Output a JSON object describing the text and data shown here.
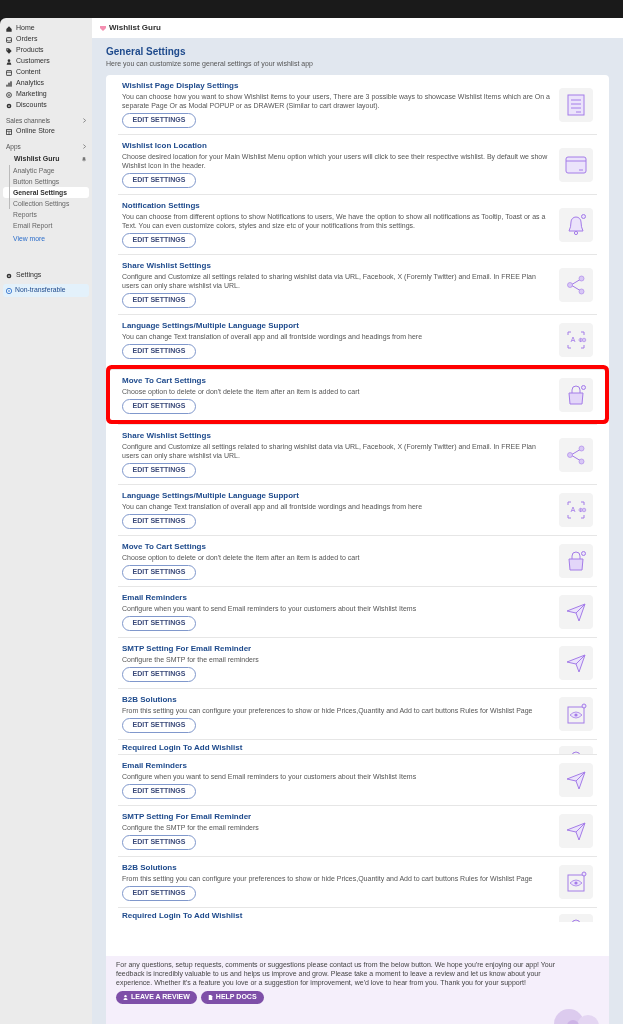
{
  "sidebar": {
    "nav": [
      {
        "label": "Home",
        "kind": "home"
      },
      {
        "label": "Orders",
        "kind": "inbox"
      },
      {
        "label": "Products",
        "kind": "tag"
      },
      {
        "label": "Customers",
        "kind": "person"
      },
      {
        "label": "Content",
        "kind": "content"
      },
      {
        "label": "Analytics",
        "kind": "chart"
      },
      {
        "label": "Marketing",
        "kind": "target"
      },
      {
        "label": "Discounts",
        "kind": "gear"
      }
    ],
    "sales_channels": {
      "heading": "Sales channels",
      "items": [
        {
          "label": "Online Store",
          "kind": "store"
        }
      ]
    },
    "apps": {
      "heading": "Apps",
      "app": {
        "label": "Wishlist Guru",
        "pinned": true
      },
      "items": [
        {
          "label": "Analytic Page",
          "selected": false
        },
        {
          "label": "Button Settings",
          "selected": false
        },
        {
          "label": "General Settings",
          "selected": true
        },
        {
          "label": "Collection Settings",
          "selected": false
        },
        {
          "label": "Reports",
          "selected": false
        },
        {
          "label": "Email Report",
          "selected": false
        }
      ],
      "view_more": "View more"
    },
    "settings": "Settings",
    "badge": "Non-transferable"
  },
  "header": {
    "title": "Wishlist Guru"
  },
  "page": {
    "title": "General Settings",
    "subtitle": "Here you can customize some general settings of your wishlist app"
  },
  "settings": [
    {
      "title": "Wishlist Page Display Settings",
      "description": "You can choose how you want to show Wishlist items to your users, There are 3 possible ways to showcase Wishlist Items which are On a separate Page Or as Modal POPUP or as DRAWER (Similar to cart drawer layout).",
      "button": "EDIT SETTINGS",
      "kind": "page",
      "highlighted": false,
      "cut": false
    },
    {
      "title": "Wishlist Icon Location",
      "description": "Choose desired location for your Main Wishlist Menu option which your users will click to see their respective wishlist. By default we show Wishlist Icon in the header.",
      "button": "EDIT SETTINGS",
      "kind": "window",
      "highlighted": false,
      "cut": false
    },
    {
      "title": "Notification Settings",
      "description": "You can choose from different options to show Notifications to users, We have the option to show all notifications as Tooltip, Toast or as a Text. You can even customize colors, styles and size etc of your notifications from this settings.",
      "button": "EDIT SETTINGS",
      "kind": "bell",
      "highlighted": false,
      "cut": false
    },
    {
      "title": "Share Wishlist Settings",
      "description": "Configure and Customize all settings related to sharing wishlist data via URL, Facebook, X (Foremly Twitter) and Email. In FREE Plan users can only share wishlist via URL.",
      "button": "EDIT SETTINGS",
      "kind": "share",
      "highlighted": false,
      "cut": false
    },
    {
      "title": "Language Settings/Multiple Language Support",
      "description": "You can change Text translation of overall app and all frontside wordings and headings from here",
      "button": "EDIT SETTINGS",
      "kind": "language",
      "highlighted": false,
      "cut": false
    },
    {
      "title": "Move To Cart Settings",
      "description": "Choose option to delete or don't delete the item after an item is added to cart",
      "button": "EDIT SETTINGS",
      "kind": "bag",
      "highlighted": true,
      "cut": false
    },
    {
      "title": "Share Wishlist Settings",
      "description": "Configure and Customize all settings related to sharing wishlist data via URL, Facebook, X (Foremly Twitter) and Email. In FREE Plan users can only share wishlist via URL.",
      "button": "EDIT SETTINGS",
      "kind": "share",
      "highlighted": false,
      "cut": false
    },
    {
      "title": "Language Settings/Multiple Language Support",
      "description": "You can change Text translation of overall app and all frontside wordings and headings from here",
      "button": "EDIT SETTINGS",
      "kind": "language",
      "highlighted": false,
      "cut": false
    },
    {
      "title": "Move To Cart Settings",
      "description": "Choose option to delete or don't delete the item after an item is added to cart",
      "button": "EDIT SETTINGS",
      "kind": "bag",
      "highlighted": false,
      "cut": false
    },
    {
      "title": "Email Reminders",
      "description": "Configure when you want to send Email reminders to your customers about their Wishlist Items",
      "button": "EDIT SETTINGS",
      "kind": "send",
      "highlighted": false,
      "cut": false
    },
    {
      "title": "SMTP Setting For Email Reminder",
      "description": "Configure the SMTP for the email reminders",
      "button": "EDIT SETTINGS",
      "kind": "send",
      "highlighted": false,
      "cut": false
    },
    {
      "title": "B2B Solutions",
      "description": "From this setting you can configure your preferences to show or hide Prices,Quantity and Add to cart buttons Rules for Wishlist Page",
      "button": "EDIT SETTINGS",
      "kind": "eye",
      "highlighted": false,
      "cut": false
    },
    {
      "title": "Required Login To Add Wishlist",
      "kind": "login",
      "cut": true
    },
    {
      "title": "Email Reminders",
      "description": "Configure when you want to send Email reminders to your customers about their Wishlist Items",
      "button": "EDIT SETTINGS",
      "kind": "send",
      "highlighted": false,
      "cut": false
    },
    {
      "title": "SMTP Setting For Email Reminder",
      "description": "Configure the SMTP for the email reminders",
      "button": "EDIT SETTINGS",
      "kind": "send",
      "highlighted": false,
      "cut": false
    },
    {
      "title": "B2B Solutions",
      "description": "From this setting you can configure your preferences to show or hide Prices,Quantity and Add to cart buttons Rules for Wishlist Page",
      "button": "EDIT SETTINGS",
      "kind": "eye",
      "highlighted": false,
      "cut": false
    },
    {
      "title": "Required Login To Add Wishlist",
      "kind": "login",
      "cut": true
    }
  ],
  "footer": {
    "text": "For any questions, setup requests, comments or suggestions please contact us from the below button. We hope you're enjoying our app! Your feedback is incredibly valuable to us and helps us improve and grow. Please take a moment to leave a review and let us know about your experience. Whether it's a feature you love or a suggestion for improvement, we'd love to hear from you. Thank you for your support!",
    "buttons": [
      {
        "label": "LEAVE A REVIEW",
        "kind": "person"
      },
      {
        "label": "HELP DOCS",
        "kind": "doc"
      }
    ]
  }
}
